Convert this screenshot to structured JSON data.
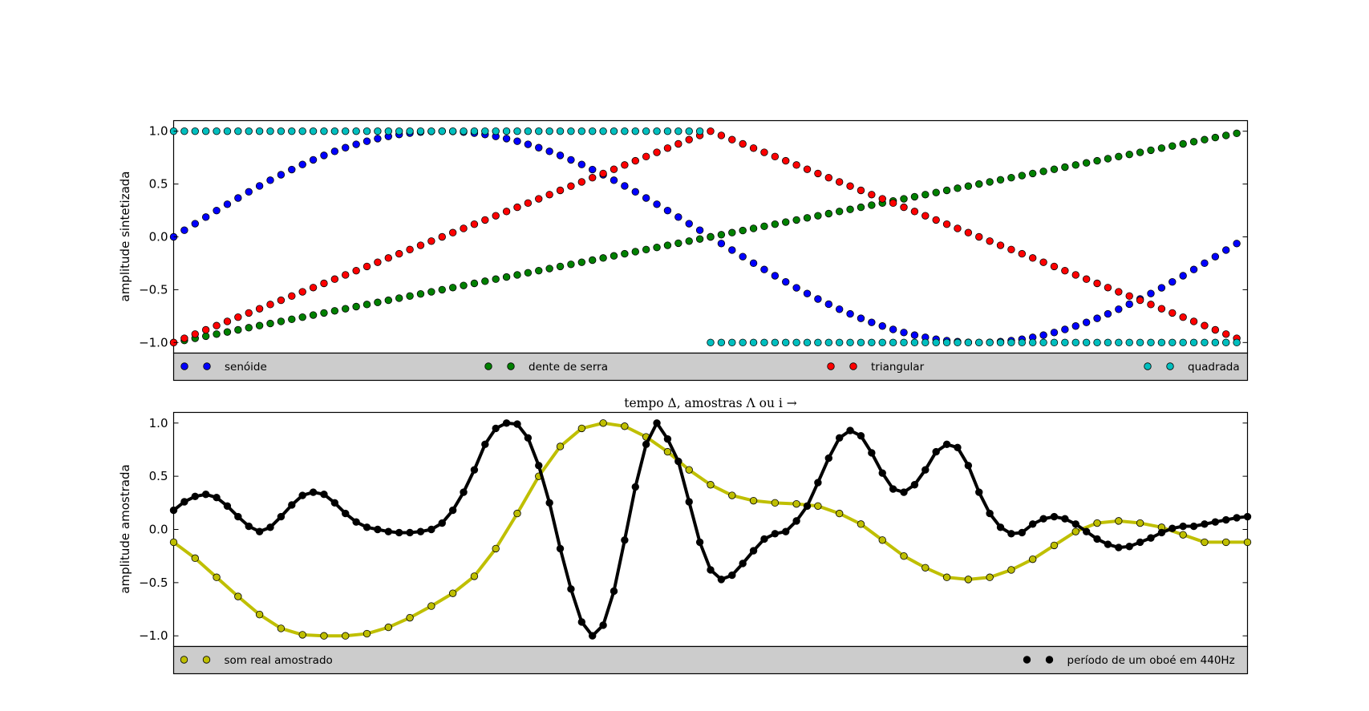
{
  "chart_data": [
    {
      "type": "scatter",
      "ylabel": "amplitude sintetizada",
      "xlim": [
        0,
        100
      ],
      "ylim": [
        -1.1,
        1.1
      ],
      "yticks": [
        "1.0",
        "0.5",
        "0.0",
        "−0.5",
        "−1.0"
      ],
      "ytick_values": [
        1.0,
        0.5,
        0.0,
        -0.5,
        -1.0
      ],
      "legend_position": "bottom, below plot",
      "grid": false,
      "series": [
        {
          "name": "senóide",
          "color": "#0000ff",
          "values": [
            0.0,
            0.063,
            0.125,
            0.187,
            0.249,
            0.309,
            0.368,
            0.426,
            0.482,
            0.536,
            0.588,
            0.637,
            0.685,
            0.729,
            0.771,
            0.809,
            0.844,
            0.876,
            0.905,
            0.93,
            0.951,
            0.969,
            0.982,
            0.992,
            0.998,
            1.0,
            0.998,
            0.992,
            0.982,
            0.969,
            0.951,
            0.93,
            0.905,
            0.876,
            0.844,
            0.809,
            0.771,
            0.729,
            0.685,
            0.637,
            0.588,
            0.536,
            0.482,
            0.426,
            0.368,
            0.309,
            0.249,
            0.187,
            0.125,
            0.063,
            0.0,
            -0.063,
            -0.125,
            -0.187,
            -0.249,
            -0.309,
            -0.368,
            -0.426,
            -0.482,
            -0.536,
            -0.588,
            -0.637,
            -0.685,
            -0.729,
            -0.771,
            -0.809,
            -0.844,
            -0.876,
            -0.905,
            -0.93,
            -0.951,
            -0.969,
            -0.982,
            -0.992,
            -0.998,
            -1.0,
            -0.998,
            -0.992,
            -0.982,
            -0.969,
            -0.951,
            -0.93,
            -0.905,
            -0.876,
            -0.844,
            -0.809,
            -0.771,
            -0.729,
            -0.685,
            -0.637,
            -0.588,
            -0.536,
            -0.482,
            -0.426,
            -0.368,
            -0.309,
            -0.249,
            -0.187,
            -0.125,
            -0.063
          ]
        },
        {
          "name": "dente de serra",
          "color": "#008000",
          "values": [
            -1.0,
            -0.98,
            -0.96,
            -0.94,
            -0.92,
            -0.9,
            -0.88,
            -0.86,
            -0.84,
            -0.82,
            -0.8,
            -0.78,
            -0.76,
            -0.74,
            -0.72,
            -0.7,
            -0.68,
            -0.66,
            -0.64,
            -0.62,
            -0.6,
            -0.58,
            -0.56,
            -0.54,
            -0.52,
            -0.5,
            -0.48,
            -0.46,
            -0.44,
            -0.42,
            -0.4,
            -0.38,
            -0.36,
            -0.34,
            -0.32,
            -0.3,
            -0.28,
            -0.26,
            -0.24,
            -0.22,
            -0.2,
            -0.18,
            -0.16,
            -0.14,
            -0.12,
            -0.1,
            -0.08,
            -0.06,
            -0.04,
            -0.02,
            0.0,
            0.02,
            0.04,
            0.06,
            0.08,
            0.1,
            0.12,
            0.14,
            0.16,
            0.18,
            0.2,
            0.22,
            0.24,
            0.26,
            0.28,
            0.3,
            0.32,
            0.34,
            0.36,
            0.38,
            0.4,
            0.42,
            0.44,
            0.46,
            0.48,
            0.5,
            0.52,
            0.54,
            0.56,
            0.58,
            0.6,
            0.62,
            0.64,
            0.66,
            0.68,
            0.7,
            0.72,
            0.74,
            0.76,
            0.78,
            0.8,
            0.82,
            0.84,
            0.86,
            0.88,
            0.9,
            0.92,
            0.94,
            0.96,
            0.98
          ]
        },
        {
          "name": "triangular",
          "color": "#ff0000",
          "values": [
            -1.0,
            -0.96,
            -0.92,
            -0.88,
            -0.84,
            -0.8,
            -0.76,
            -0.72,
            -0.68,
            -0.64,
            -0.6,
            -0.56,
            -0.52,
            -0.48,
            -0.44,
            -0.4,
            -0.36,
            -0.32,
            -0.28,
            -0.24,
            -0.2,
            -0.16,
            -0.12,
            -0.08,
            -0.04,
            0.0,
            0.04,
            0.08,
            0.12,
            0.16,
            0.2,
            0.24,
            0.28,
            0.32,
            0.36,
            0.4,
            0.44,
            0.48,
            0.52,
            0.56,
            0.6,
            0.64,
            0.68,
            0.72,
            0.76,
            0.8,
            0.84,
            0.88,
            0.92,
            0.96,
            1.0,
            0.96,
            0.92,
            0.88,
            0.84,
            0.8,
            0.76,
            0.72,
            0.68,
            0.64,
            0.6,
            0.56,
            0.52,
            0.48,
            0.44,
            0.4,
            0.36,
            0.32,
            0.28,
            0.24,
            0.2,
            0.16,
            0.12,
            0.08,
            0.04,
            0.0,
            -0.04,
            -0.08,
            -0.12,
            -0.16,
            -0.2,
            -0.24,
            -0.28,
            -0.32,
            -0.36,
            -0.4,
            -0.44,
            -0.48,
            -0.52,
            -0.56,
            -0.6,
            -0.64,
            -0.68,
            -0.72,
            -0.76,
            -0.8,
            -0.84,
            -0.88,
            -0.92,
            -0.96
          ]
        },
        {
          "name": "quadrada",
          "color": "#00bfbf",
          "values": [
            1,
            1,
            1,
            1,
            1,
            1,
            1,
            1,
            1,
            1,
            1,
            1,
            1,
            1,
            1,
            1,
            1,
            1,
            1,
            1,
            1,
            1,
            1,
            1,
            1,
            1,
            1,
            1,
            1,
            1,
            1,
            1,
            1,
            1,
            1,
            1,
            1,
            1,
            1,
            1,
            1,
            1,
            1,
            1,
            1,
            1,
            1,
            1,
            1,
            1,
            -1,
            -1,
            -1,
            -1,
            -1,
            -1,
            -1,
            -1,
            -1,
            -1,
            -1,
            -1,
            -1,
            -1,
            -1,
            -1,
            -1,
            -1,
            -1,
            -1,
            -1,
            -1,
            -1,
            -1,
            -1,
            -1,
            -1,
            -1,
            -1,
            -1,
            -1,
            -1,
            -1,
            -1,
            -1,
            -1,
            -1,
            -1,
            -1,
            -1,
            -1,
            -1,
            -1,
            -1,
            -1,
            -1,
            -1,
            -1,
            -1,
            -1
          ]
        }
      ]
    },
    {
      "type": "line",
      "title": "tempo Δ, amostras Λ ou i →",
      "ylabel": "amplitude amostrada",
      "xlim": [
        0,
        100
      ],
      "ylim": [
        -1.1,
        1.1
      ],
      "yticks": [
        "1.0",
        "0.5",
        "0.0",
        "−0.5",
        "−1.0"
      ],
      "ytick_values": [
        1.0,
        0.5,
        0.0,
        -0.5,
        -1.0
      ],
      "legend_position": "bottom, below plot",
      "grid": false,
      "series": [
        {
          "name": "som real amostrado",
          "color": "#bfbf00",
          "marker": "circle",
          "line": true,
          "x": [
            0,
            2,
            4,
            6,
            8,
            10,
            12,
            14,
            16,
            18,
            20,
            22,
            24,
            26,
            28,
            30,
            32,
            34,
            36,
            38,
            40,
            42,
            44,
            46,
            48,
            50,
            52,
            54,
            56,
            58,
            60,
            62,
            64,
            66,
            68,
            70,
            72,
            74,
            76,
            78,
            80,
            82,
            84,
            86,
            88,
            90,
            92,
            94,
            96,
            98,
            100
          ],
          "values": [
            -0.12,
            -0.27,
            -0.45,
            -0.63,
            -0.8,
            -0.93,
            -0.99,
            -1.0,
            -1.0,
            -0.98,
            -0.92,
            -0.83,
            -0.72,
            -0.6,
            -0.44,
            -0.18,
            0.15,
            0.5,
            0.78,
            0.95,
            1.0,
            0.97,
            0.87,
            0.73,
            0.56,
            0.42,
            0.32,
            0.27,
            0.25,
            0.24,
            0.22,
            0.15,
            0.05,
            -0.1,
            -0.25,
            -0.36,
            -0.45,
            -0.47,
            -0.45,
            -0.38,
            -0.28,
            -0.15,
            -0.02,
            0.06,
            0.08,
            0.06,
            0.02,
            -0.05,
            -0.12,
            -0.12,
            -0.12
          ]
        },
        {
          "name": "período de um oboé em 440Hz",
          "color": "#000000",
          "marker": "circle",
          "line": true,
          "x": [
            0,
            1,
            2,
            3,
            4,
            5,
            6,
            7,
            8,
            9,
            10,
            11,
            12,
            13,
            14,
            15,
            16,
            17,
            18,
            19,
            20,
            21,
            22,
            23,
            24,
            25,
            26,
            27,
            28,
            29,
            30,
            31,
            32,
            33,
            34,
            35,
            36,
            37,
            38,
            39,
            40,
            41,
            42,
            43,
            44,
            45,
            46,
            47,
            48,
            49,
            50,
            51,
            52,
            53,
            54,
            55,
            56,
            57,
            58,
            59,
            60,
            61,
            62,
            63,
            64,
            65,
            66,
            67,
            68,
            69,
            70,
            71,
            72,
            73,
            74,
            75,
            76,
            77,
            78,
            79,
            80,
            81,
            82,
            83,
            84,
            85,
            86,
            87,
            88,
            89,
            90,
            91,
            92,
            93,
            94,
            95,
            96,
            97,
            98,
            99,
            100
          ],
          "values": [
            0.18,
            0.26,
            0.31,
            0.33,
            0.3,
            0.22,
            0.12,
            0.03,
            -0.02,
            0.02,
            0.12,
            0.23,
            0.32,
            0.35,
            0.33,
            0.25,
            0.15,
            0.07,
            0.02,
            0.0,
            -0.02,
            -0.03,
            -0.03,
            -0.02,
            0.0,
            0.06,
            0.18,
            0.35,
            0.56,
            0.8,
            0.95,
            1.0,
            0.99,
            0.86,
            0.6,
            0.25,
            -0.18,
            -0.56,
            -0.87,
            -1.0,
            -0.9,
            -0.58,
            -0.1,
            0.4,
            0.8,
            1.0,
            0.85,
            0.64,
            0.26,
            -0.12,
            -0.38,
            -0.47,
            -0.43,
            -0.32,
            -0.2,
            -0.09,
            -0.04,
            -0.02,
            0.08,
            0.22,
            0.44,
            0.67,
            0.86,
            0.93,
            0.88,
            0.72,
            0.53,
            0.38,
            0.35,
            0.42,
            0.56,
            0.73,
            0.8,
            0.77,
            0.6,
            0.35,
            0.15,
            0.02,
            -0.04,
            -0.03,
            0.05,
            0.1,
            0.12,
            0.1,
            0.05,
            -0.02,
            -0.09,
            -0.14,
            -0.17,
            -0.16,
            -0.12,
            -0.08,
            -0.03,
            0.01,
            0.03,
            0.03,
            0.05,
            0.07,
            0.09,
            0.11,
            0.12
          ]
        }
      ]
    }
  ]
}
